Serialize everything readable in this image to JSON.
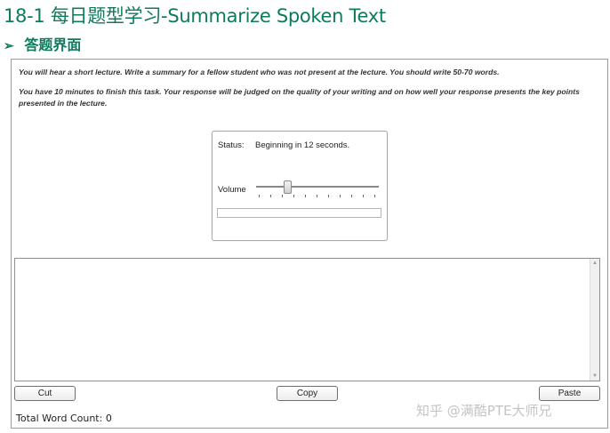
{
  "doc": {
    "title": "18-1 每日题型学习-Summarize Spoken Text",
    "subtitle_arrow": "➢",
    "subtitle": "答题界面"
  },
  "task": {
    "instruction_1": "You will hear a short lecture. Write a summary for a fellow student who was not present at the lecture. You should write 50-70 words.",
    "instruction_2": "You have 10 minutes to finish this task. Your response will be judged on the quality of your writing and on how well your response presents the key points presented in the lecture."
  },
  "player": {
    "status_label": "Status:",
    "status_value": "Beginning in 12 seconds.",
    "volume_label": "Volume",
    "volume_level": 0.25,
    "progress": 0
  },
  "editor": {
    "text": ""
  },
  "buttons": {
    "cut": "Cut",
    "copy": "Copy",
    "paste": "Paste"
  },
  "footer": {
    "word_count": "Total Word Count: 0"
  },
  "watermark": "知乎 @满酷PTE大师兄"
}
